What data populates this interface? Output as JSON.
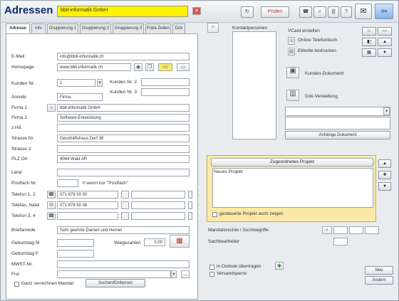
{
  "window": {
    "title": "Adressen",
    "name_value": "bbit-informatik GmbH"
  },
  "toolbar": {
    "edit_label": "Prüfen",
    "btn_bars": "|||",
    "btn_paste": "?"
  },
  "tabs": [
    {
      "label": "Adresse"
    },
    {
      "label": "Info"
    },
    {
      "label": "Gruppierung 1"
    },
    {
      "label": "Gruppierung 2"
    },
    {
      "label": "Gruppierung 3"
    },
    {
      "label": "Freie Zeilen"
    },
    {
      "label": "Dok"
    }
  ],
  "form": {
    "email_label": "E-Mail",
    "email_value": "info@bbit-informatik.ch",
    "homepage_label": "Homepage",
    "homepage_value": "www.bbit-informatik.ch",
    "kunden_nr_label": "Kunden Nr.",
    "kunden_nr_value": "1",
    "kunden_nr2_label": "Kunden Nr. 2",
    "kunden_nr3_label": "Kunden Nr. 3",
    "anrede_label": "Anrede",
    "anrede_value": "Firma",
    "firma1_label": "Firma 1",
    "firma1_value": "bbit-informatik GmbH",
    "firma2_label": "Firma 2",
    "firma2_value": "Software-Entwicklung",
    "zhd_label": "z.Hd.",
    "strasse_label": "Strasse Nr.",
    "strasse_value": "Geschäftshaus Dorf 38",
    "strasse2_label": "Strasse 2",
    "plz_label": "PLZ Ort",
    "plz_value": "9044 Wald AR",
    "land_label": "Land",
    "postfach_label": "Postfach Nr.",
    "postfach_hint": "0 wenn nur \"Postfach\"",
    "tel12_label": "Telefon 1, 2",
    "tel1_value": "071 878 50 00",
    "telnatel_label": "Telefax, Natel",
    "fax_value": "071 878 50 06",
    "tel34_label": "Telefon 3, 4",
    "briefanrede_label": "Briefanrede",
    "briefanrede_value": "Sehr geehrte Damen und Herren",
    "geb_m_label": "Geburtstag M",
    "wiegezahlen_label": "Wiegezahlen",
    "wiegezahlen_value": "0.00",
    "geb_f_label": "Geburtstag F",
    "mwst_label": "MWST-Nr.",
    "frei_label": "Frei",
    "ganz_label": "Ganz verrechnen Mandat",
    "search_btn": "Suchen/Entfernen"
  },
  "right": {
    "kontakt_label": "Kontaktpersonen",
    "vcard_label": "VCard erstellen",
    "online_label": "Online Telefonbuch",
    "etikette_label": "Etikette bedrucken",
    "kundendok_label": "Kunden-Dokument",
    "dokverw_label": "Dok-Verwaltung",
    "add_dok_btn": "Anhänge Dokument",
    "projekt_header": "Zugeordnetes Projekt",
    "projekt_col": "Neues Projekt",
    "projekt_check": "gesteuerte Projekt auch zeigen",
    "mandant_label": "Mandatsrechte / Suchbegriffe",
    "sachbearbeiter_label": "Sachbearbeiter",
    "outlook_label": "in Outlook übertragen",
    "versand_label": "Versandsperre",
    "neu_btn": "Neu",
    "adresse_btn": "Ändern"
  },
  "colors": {
    "name_highlight": "#fff200",
    "projekt_bg": "#fbe9a8",
    "title_blue": "#0b2a6a"
  }
}
